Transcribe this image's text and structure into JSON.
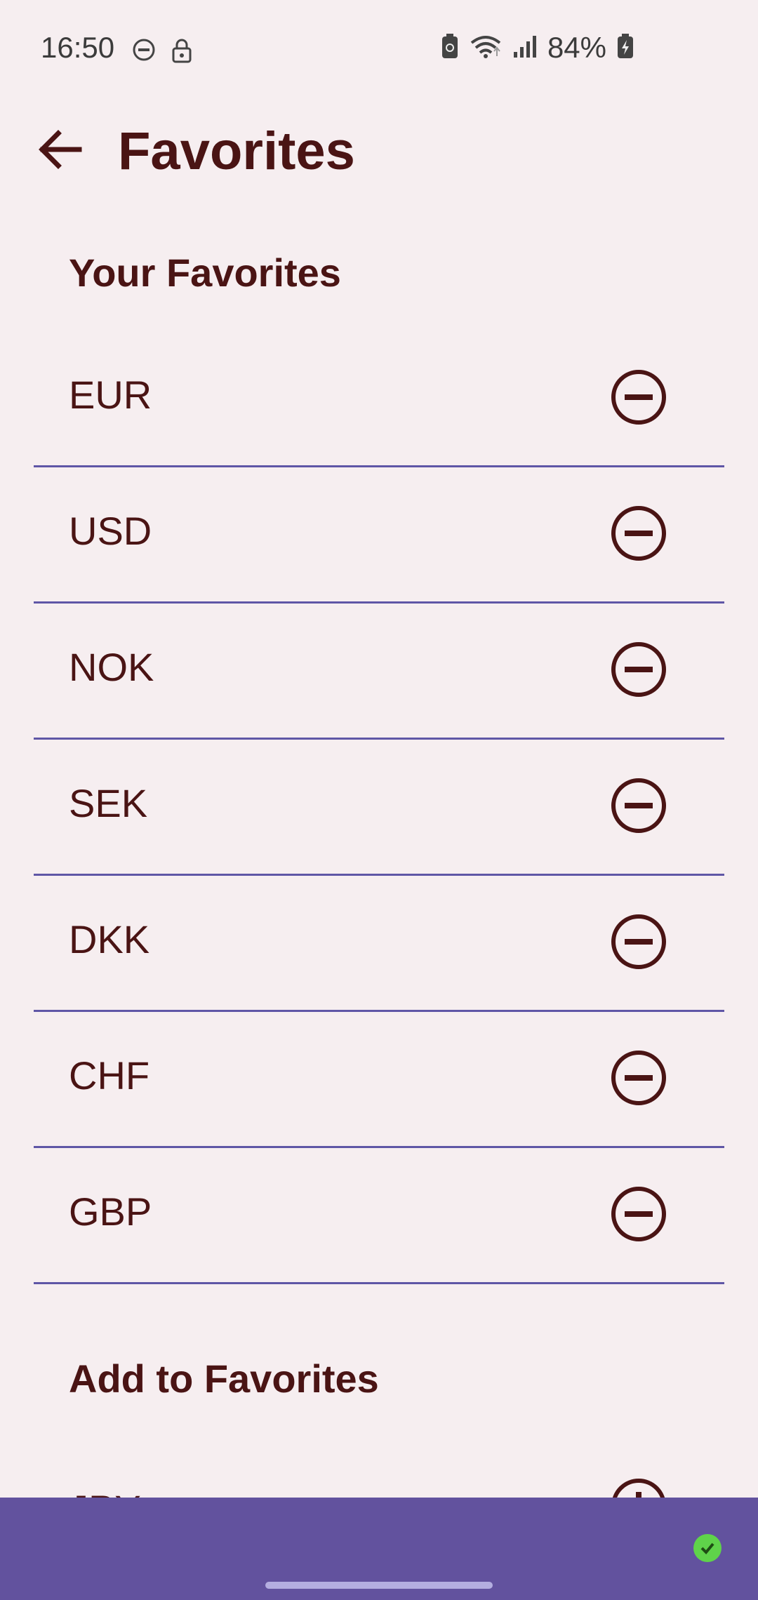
{
  "status_bar": {
    "time": "16:50",
    "battery": "84%",
    "icons": [
      "do-not-disturb-icon",
      "lock-icon",
      "battery-saver-icon",
      "wifi-icon",
      "signal-icon",
      "battery-charging-icon"
    ]
  },
  "header": {
    "title": "Favorites",
    "back_icon": "arrow-back-icon"
  },
  "favorites": {
    "title": "Your Favorites",
    "items": [
      {
        "code": "EUR",
        "action_icon": "remove-circle-icon"
      },
      {
        "code": "USD",
        "action_icon": "remove-circle-icon"
      },
      {
        "code": "NOK",
        "action_icon": "remove-circle-icon"
      },
      {
        "code": "SEK",
        "action_icon": "remove-circle-icon"
      },
      {
        "code": "DKK",
        "action_icon": "remove-circle-icon"
      },
      {
        "code": "CHF",
        "action_icon": "remove-circle-icon"
      },
      {
        "code": "GBP",
        "action_icon": "remove-circle-icon"
      }
    ]
  },
  "add_section": {
    "title": "Add to Favorites",
    "items": [
      {
        "code": "JPY",
        "action_icon": "add-circle-icon"
      }
    ]
  },
  "colors": {
    "background": "#f6eef0",
    "text": "#4a1414",
    "divider": "#5f56a6",
    "banner": "#62529e",
    "success": "#5fd34a"
  }
}
